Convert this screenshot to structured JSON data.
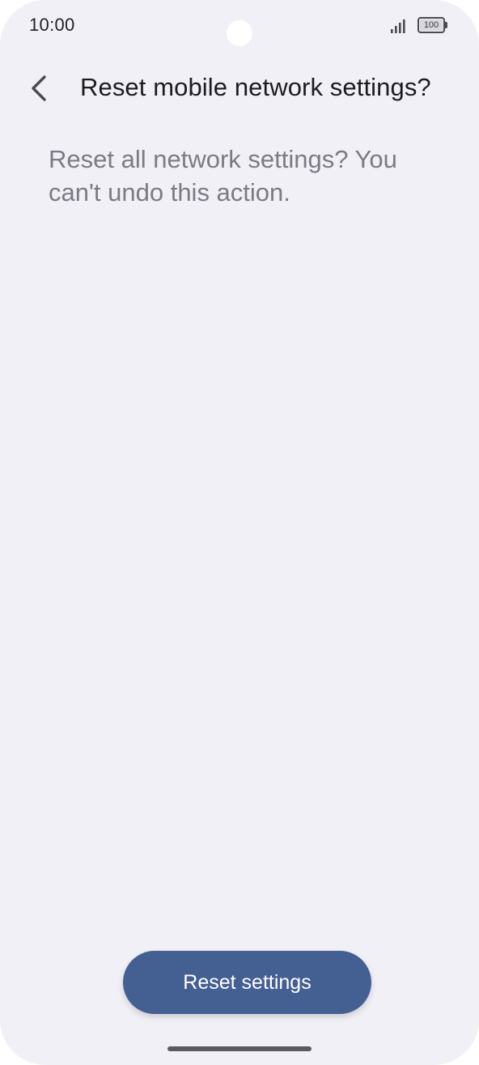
{
  "status_bar": {
    "time": "10:00",
    "battery_level": "100",
    "icons": [
      "signal-icon",
      "battery-icon"
    ]
  },
  "header": {
    "back_icon": "chevron-left-icon",
    "title": "Reset mobile network settings?"
  },
  "content": {
    "description": "Reset all network settings? You can't undo this action."
  },
  "actions": {
    "reset_label": "Reset settings"
  },
  "colors": {
    "background": "#f0f0f6",
    "primary_button": "#445f92",
    "title_text": "#1c1c20",
    "secondary_text": "#7b7b86"
  }
}
